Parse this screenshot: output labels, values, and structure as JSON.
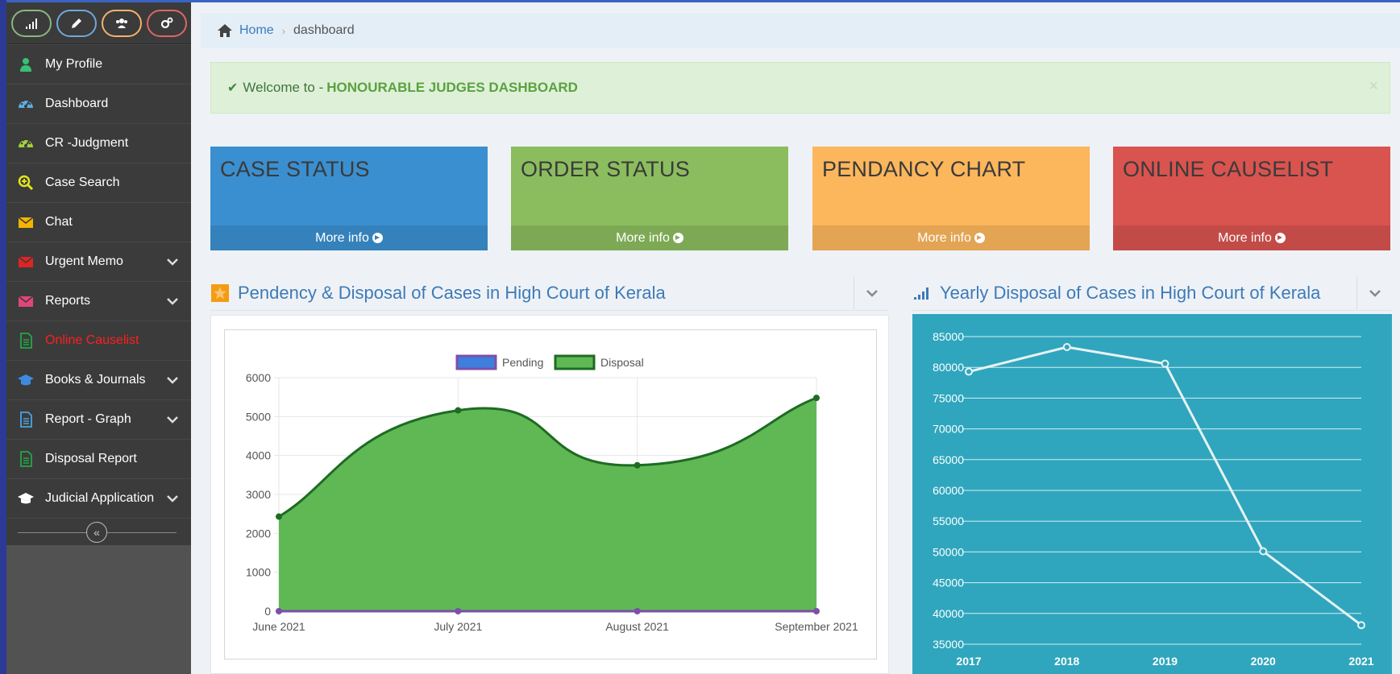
{
  "shortcuts": [
    {
      "name": "stats-shortcut",
      "icon": "signal-icon",
      "color": "#8bb77b"
    },
    {
      "name": "edit-shortcut",
      "icon": "pencil-icon",
      "color": "#6fa8dc"
    },
    {
      "name": "users-shortcut",
      "icon": "users-icon",
      "color": "#f6b26b"
    },
    {
      "name": "settings-shortcut",
      "icon": "cogs-icon",
      "color": "#e06666"
    }
  ],
  "sidebar": {
    "items": [
      {
        "label": "My Profile",
        "icon": "user-icon",
        "icon_color": "#38c172",
        "has_caret": false
      },
      {
        "label": "Dashboard",
        "icon": "dashboard-icon",
        "icon_color": "#5dade2",
        "has_caret": false
      },
      {
        "label": "CR -Judgment",
        "icon": "dashboard-icon",
        "icon_color": "#a3d13a",
        "has_caret": false
      },
      {
        "label": "Case Search",
        "icon": "search-plus-icon",
        "icon_color": "#e5e51b",
        "has_caret": false
      },
      {
        "label": "Chat",
        "icon": "envelope-icon",
        "icon_color": "#f4b400",
        "has_caret": false
      },
      {
        "label": "Urgent Memo",
        "icon": "envelope-icon",
        "icon_color": "#e02424",
        "has_caret": true
      },
      {
        "label": "Reports",
        "icon": "envelope-icon",
        "icon_color": "#e0457b",
        "has_caret": true
      },
      {
        "label": "Online Causelist",
        "icon": "file-icon",
        "icon_color": "#22a745",
        "has_caret": false,
        "active": true
      },
      {
        "label": "Books & Journals",
        "icon": "graduation-cap-icon",
        "icon_color": "#3d8be0",
        "has_caret": true
      },
      {
        "label": "Report - Graph",
        "icon": "file-icon",
        "icon_color": "#4aa3df",
        "has_caret": true
      },
      {
        "label": "Disposal Report",
        "icon": "file-icon",
        "icon_color": "#22a745",
        "has_caret": false
      },
      {
        "label": "Judicial Application",
        "icon": "graduation-cap-icon",
        "icon_color": "#ffffff",
        "has_caret": true
      }
    ]
  },
  "breadcrumb": {
    "home": "Home",
    "current": "dashboard"
  },
  "alert": {
    "prefix": "Welcome to -",
    "strong": "HONOURABLE JUDGES DASHBOARD",
    "close": "×"
  },
  "tiles": [
    {
      "title": "CASE STATUS",
      "footer": "More info",
      "bg": "#3a8fd0",
      "foot_bg": "#3581bb"
    },
    {
      "title": "ORDER STATUS",
      "footer": "More info",
      "bg": "#8bbd5e",
      "foot_bg": "#7da955"
    },
    {
      "title": "PENDANCY CHART",
      "footer": "More info",
      "bg": "#fcb65c",
      "foot_bg": "#e3a453"
    },
    {
      "title": "ONLINE CAUSELIST",
      "footer": "More info",
      "bg": "#d9534f",
      "foot_bg": "#c34b47"
    }
  ],
  "panels": {
    "left_title": "Pendency & Disposal of Cases in High Court of Kerala",
    "right_title": "Yearly Disposal of Cases in High Court of Kerala"
  },
  "chart_data": [
    {
      "type": "area",
      "categories": [
        "June 2021",
        "July 2021",
        "August 2021",
        "September 2021"
      ],
      "series": [
        {
          "name": "Pending",
          "values": [
            0,
            0,
            0,
            0
          ],
          "color": "#7d4fa8",
          "fill": "#3d7fdc"
        },
        {
          "name": "Disposal",
          "values": [
            2430,
            5160,
            3750,
            5480
          ],
          "color": "#1e6b23",
          "fill": "#5fb854"
        }
      ],
      "yticks": [
        0,
        1000,
        2000,
        3000,
        4000,
        5000,
        6000
      ],
      "ylim": [
        0,
        6000
      ],
      "legend": "top",
      "grid": true
    },
    {
      "type": "line",
      "categories": [
        "2017",
        "2018",
        "2019",
        "2020",
        "2021"
      ],
      "series": [
        {
          "values": [
            79300,
            83300,
            80600,
            50100,
            38100
          ],
          "color": "#e8f2f4"
        }
      ],
      "yticks": [
        35000,
        40000,
        45000,
        50000,
        55000,
        60000,
        65000,
        70000,
        75000,
        80000,
        85000
      ],
      "ylim": [
        35000,
        85000
      ],
      "grid": true,
      "background": "#2fa6bd"
    }
  ]
}
